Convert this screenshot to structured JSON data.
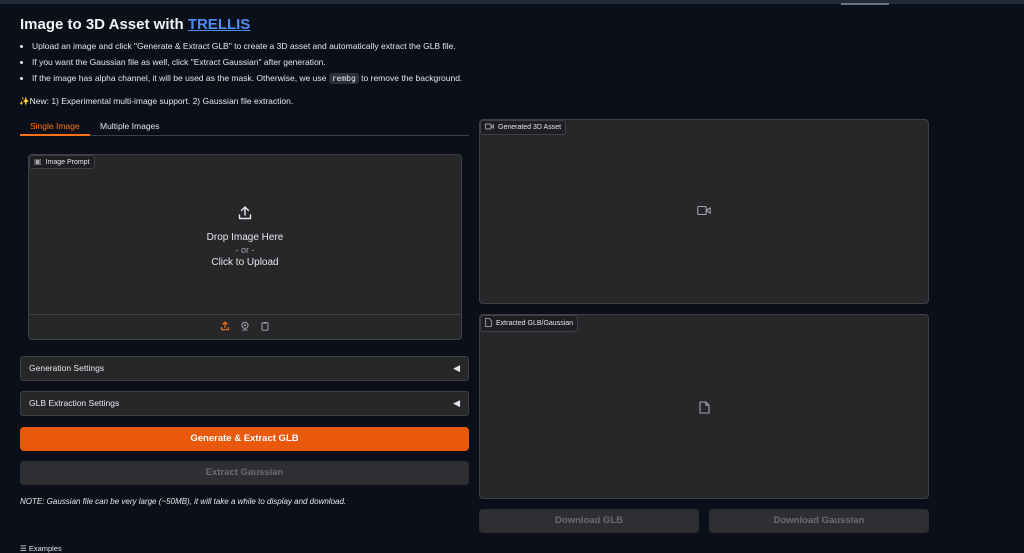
{
  "header": {
    "title_prefix": "Image to 3D Asset with ",
    "title_link": "TRELLIS"
  },
  "instructions": [
    "Upload an image and click \"Generate & Extract GLB\" to create a 3D asset and automatically extract the GLB file.",
    "If you want the Gaussian file as well, click \"Extract Gaussian\" after generation."
  ],
  "instruction3": {
    "before": "If the image has alpha channel, it will be used as the mask. Otherwise, we use ",
    "code": "rembg",
    "after": " to remove the background."
  },
  "news": {
    "icon": "sparkles-icon",
    "text": "New: 1) Experimental multi-image support. 2) Gaussian file extraction."
  },
  "tabs": [
    {
      "label": "Single Image",
      "active": true
    },
    {
      "label": "Multiple Images",
      "active": false
    }
  ],
  "image_prompt": {
    "label": "Image Prompt",
    "drop_text": "Drop Image Here",
    "or_text": "- or -",
    "click_text": "Click to Upload",
    "sources": [
      "upload-icon",
      "webcam-icon",
      "clipboard-icon"
    ]
  },
  "accordions": {
    "generation": "Generation Settings",
    "glb": "GLB Extraction Settings"
  },
  "buttons": {
    "generate": "Generate & Extract GLB",
    "extract_gaussian": "Extract Gaussian",
    "download_glb": "Download GLB",
    "download_gaussian": "Download Gaussian"
  },
  "note": "NOTE: Gaussian file can be very large (~50MB), it will take a while to display and download.",
  "outputs": {
    "video_label": "Generated 3D Asset",
    "model_label": "Extracted GLB/Gaussian"
  },
  "examples": {
    "label": "Examples"
  },
  "colors": {
    "background": "#0b0f19",
    "accent": "#ea580c",
    "link": "#4f8df5",
    "panel": "#27272a"
  }
}
